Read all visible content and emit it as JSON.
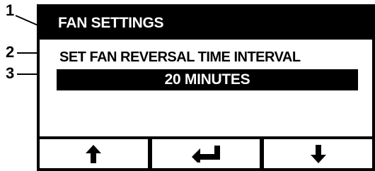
{
  "callouts": [
    "1",
    "2",
    "3"
  ],
  "screen": {
    "title": "FAN SETTINGS",
    "prompt": "SET FAN REVERSAL TIME INTERVAL",
    "value": "20 MINUTES"
  },
  "softkeys": [
    {
      "icon": "arrow-up-icon"
    },
    {
      "icon": "enter-icon"
    },
    {
      "icon": "arrow-down-icon"
    }
  ],
  "colors": {
    "foreground": "#000000",
    "background": "#ffffff"
  }
}
